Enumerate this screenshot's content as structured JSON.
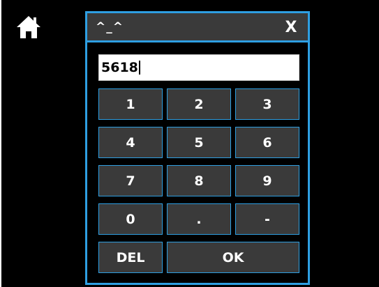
{
  "dialog": {
    "title": "^_^",
    "close_label": "X",
    "input_value": "5618"
  },
  "keypad": {
    "k1": "1",
    "k2": "2",
    "k3": "3",
    "k4": "4",
    "k5": "5",
    "k6": "6",
    "k7": "7",
    "k8": "8",
    "k9": "9",
    "k0": "0",
    "kdot": ".",
    "kminus": "-",
    "del": "DEL",
    "ok": "OK"
  },
  "icons": {
    "home": "home-icon"
  },
  "colors": {
    "accent": "#2e9fe2",
    "key_bg": "#3a3a3a",
    "background": "#000000"
  }
}
